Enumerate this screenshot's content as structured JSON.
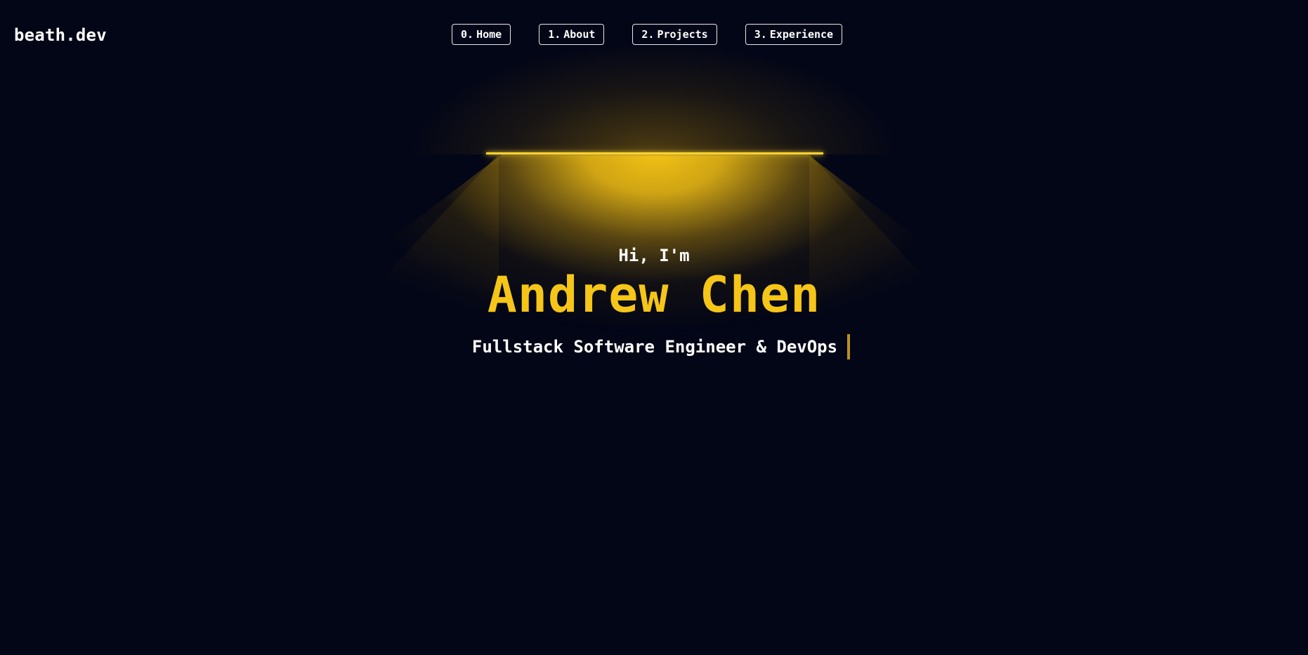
{
  "brand": {
    "logo_text": "beath.dev"
  },
  "nav": {
    "items": [
      {
        "index": "0.",
        "label": "Home"
      },
      {
        "index": "1.",
        "label": "About"
      },
      {
        "index": "2.",
        "label": "Projects"
      },
      {
        "index": "3.",
        "label": "Experience"
      }
    ]
  },
  "hero": {
    "greeting": "Hi, I'm",
    "name": "Andrew Chen",
    "role": "Fullstack Software Engineer & DevOps"
  },
  "colors": {
    "background": "#030617",
    "accent": "#f5c518",
    "lamp": "#fbd234",
    "text": "#ffffff"
  }
}
